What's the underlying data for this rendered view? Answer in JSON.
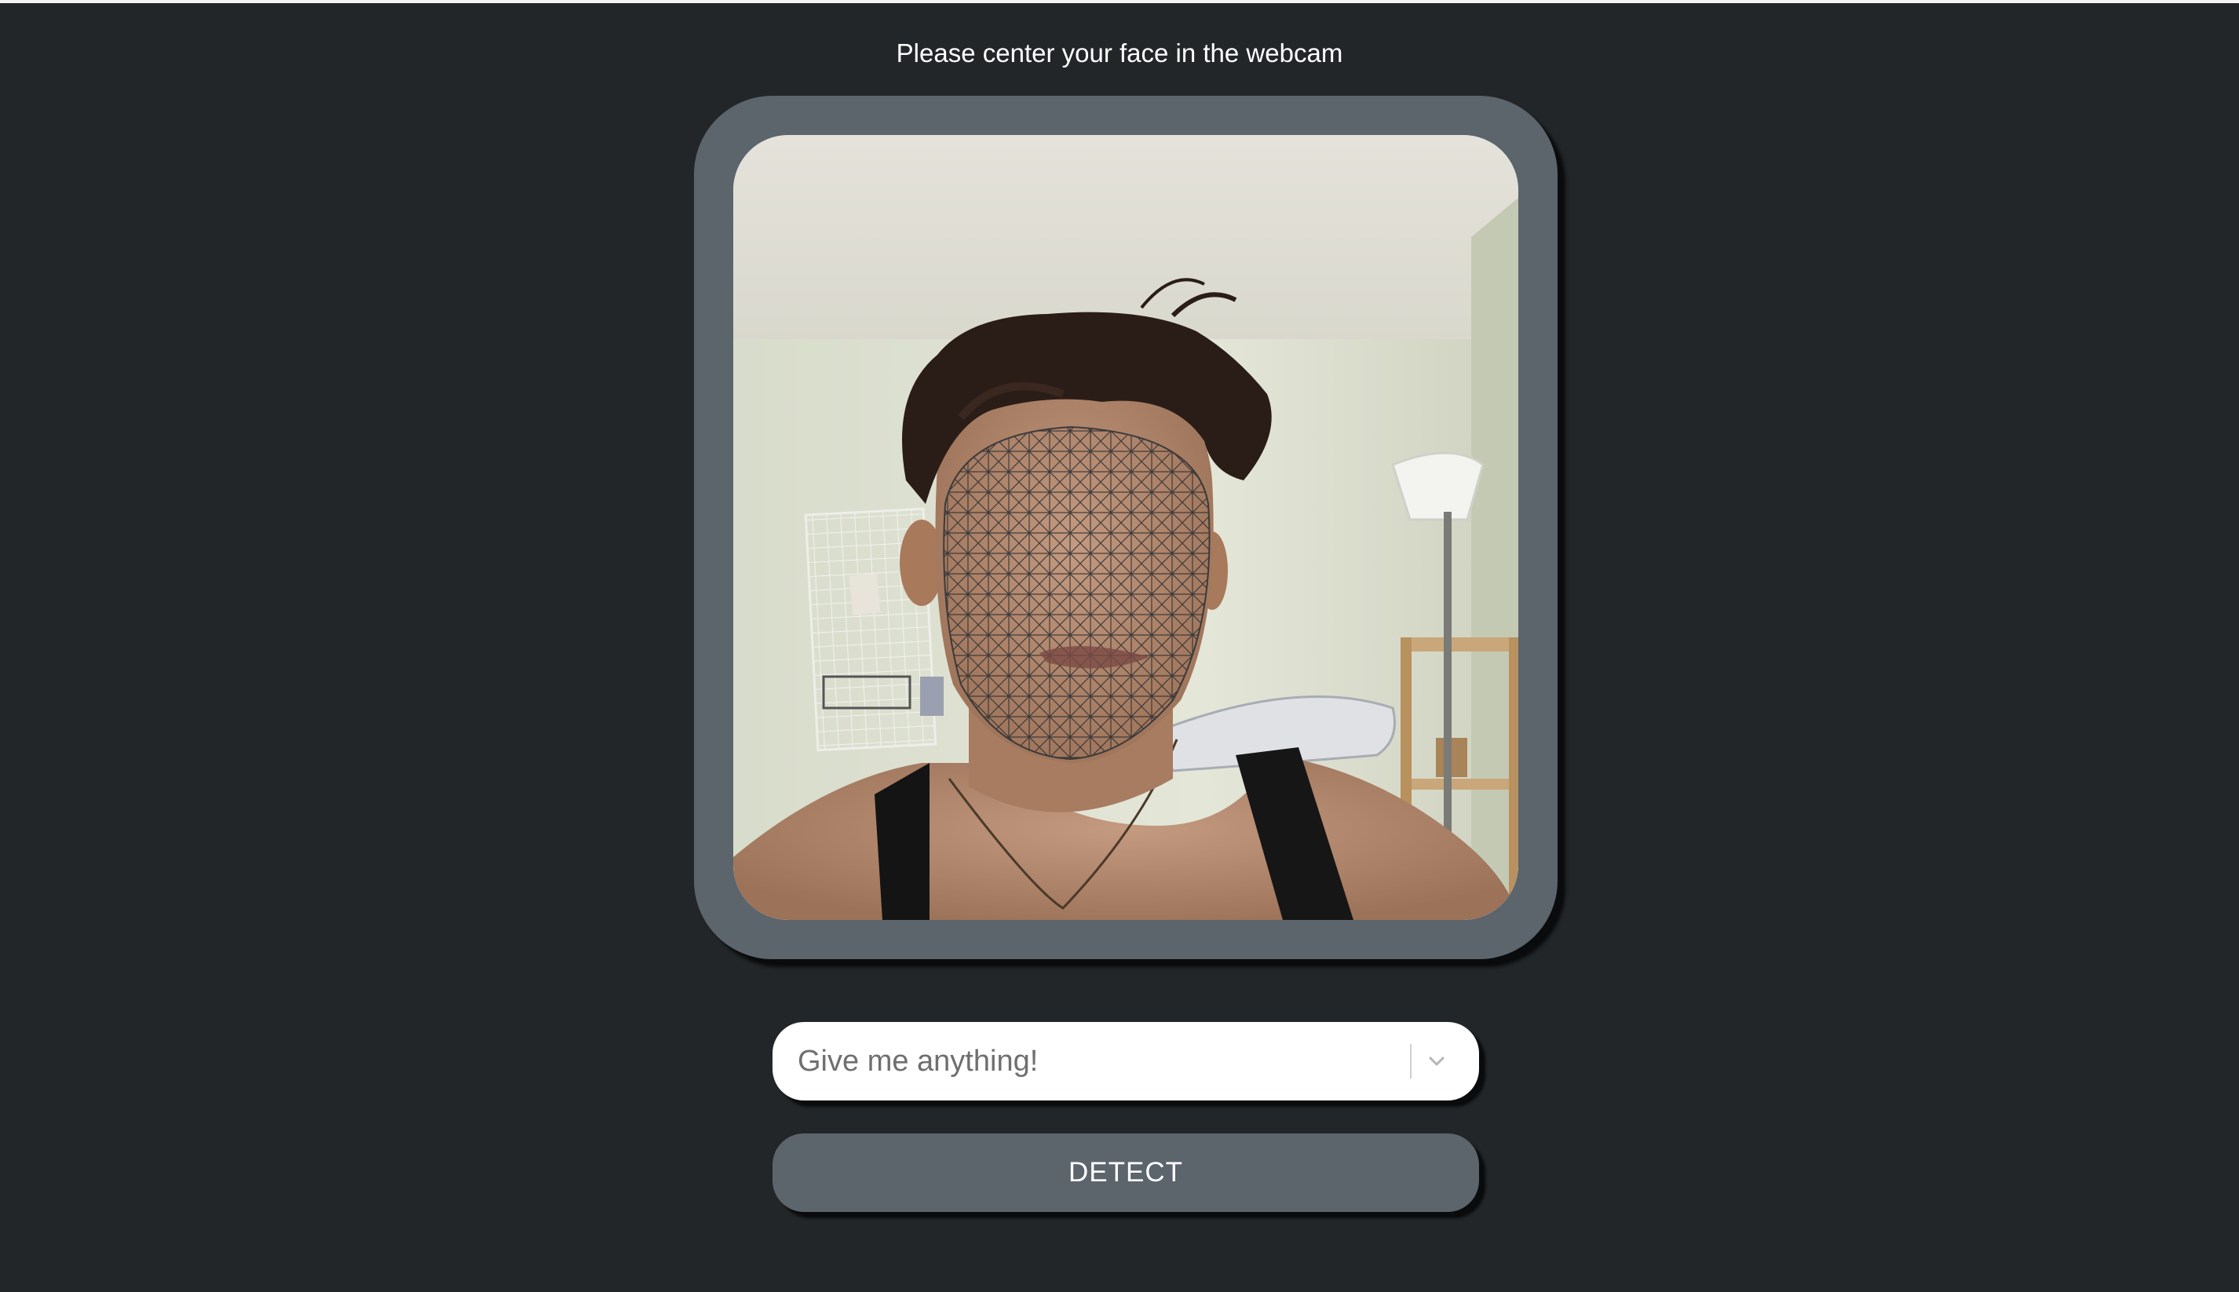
{
  "instruction": "Please center your face in the webcam",
  "webcam": {
    "overlay": "face-mesh"
  },
  "selector": {
    "placeholder": "Give me anything!",
    "icon": "chevron-down-icon"
  },
  "detect_button": {
    "label": "DETECT"
  },
  "colors": {
    "background": "#222629",
    "frame": "#5c646c",
    "button": "#5c646c",
    "text": "#ffffff",
    "mesh": "#2b2f34"
  }
}
